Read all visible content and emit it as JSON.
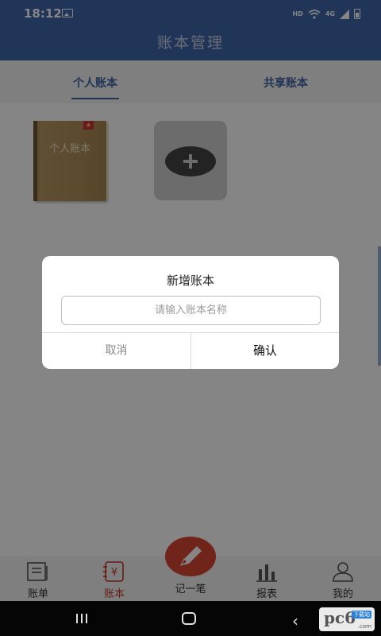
{
  "status_bar": {
    "time": "18:12",
    "hd": "HD",
    "network": "4G"
  },
  "header": {
    "title": "账本管理"
  },
  "tabs": [
    {
      "label": "个人账本",
      "active": true
    },
    {
      "label": "共享账本",
      "active": false
    }
  ],
  "ledgers": [
    {
      "name": "个人账本"
    }
  ],
  "bottom_nav": {
    "items": [
      {
        "label": "账单",
        "icon": "bill-icon"
      },
      {
        "label": "账本",
        "icon": "ledger-icon",
        "active": true
      },
      {
        "label": "报表",
        "icon": "chart-icon"
      },
      {
        "label": "我的",
        "icon": "user-icon"
      }
    ],
    "center_label": "记一笔"
  },
  "dialog": {
    "title": "新增账本",
    "input_placeholder": "请输入账本名称",
    "input_value": "",
    "cancel_label": "取消",
    "confirm_label": "确认"
  },
  "watermark": {
    "text": "pc6",
    "badge": "下载站",
    "url": ".com"
  },
  "colors": {
    "primary": "#3f67a8",
    "accent": "#d64533"
  }
}
